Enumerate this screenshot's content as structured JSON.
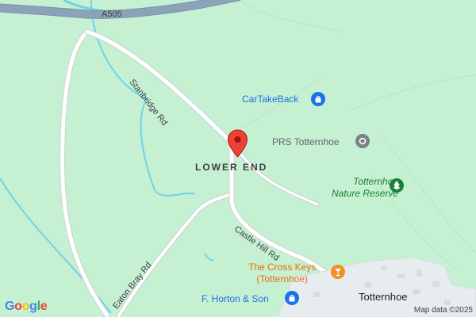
{
  "map": {
    "colors": {
      "land": "#c6f0d2",
      "road": "#ffffff",
      "road_edge": "#c9d3d0",
      "highway": "#8ba3b8",
      "water": "#6fd3e9",
      "pin": "#ea4335",
      "poi_blue": "#1a73e8",
      "poi_gray": "#7b8287",
      "poi_green": "#188038",
      "poi_orange": "#f0901f"
    },
    "roads": {
      "a505": "A505",
      "stanbridge": "Stanbridge Rd",
      "castle_hill": "Castle Hill Rd",
      "eaton_bray": "Eaton Bray Rd"
    },
    "place": "LOWER END",
    "town": "Totternhoe",
    "pois": {
      "cartakeback": {
        "name": "CarTakeBack",
        "icon": "shopping-bag-icon"
      },
      "prs": {
        "name": "PRS Totternhoe",
        "icon": "pin-dot-icon"
      },
      "reserve": {
        "line1": "Totternhoe",
        "line2": "Nature Reserve",
        "icon": "tree-icon"
      },
      "cross_keys": {
        "line1": "The Cross Keys",
        "line2": "(Totternhoe)",
        "icon": "cocktail-icon"
      },
      "horton": {
        "name": "F. Horton & Son",
        "icon": "shopping-bag-icon"
      }
    },
    "dropped_pin": "location-pin-icon"
  },
  "footer": {
    "logo": {
      "letters": [
        "G",
        "o",
        "o",
        "g",
        "l",
        "e"
      ],
      "colors": [
        "#4285f4",
        "#ea4335",
        "#fbbc05",
        "#4285f4",
        "#34a853",
        "#ea4335"
      ]
    },
    "attribution": "Map data ©2025"
  }
}
